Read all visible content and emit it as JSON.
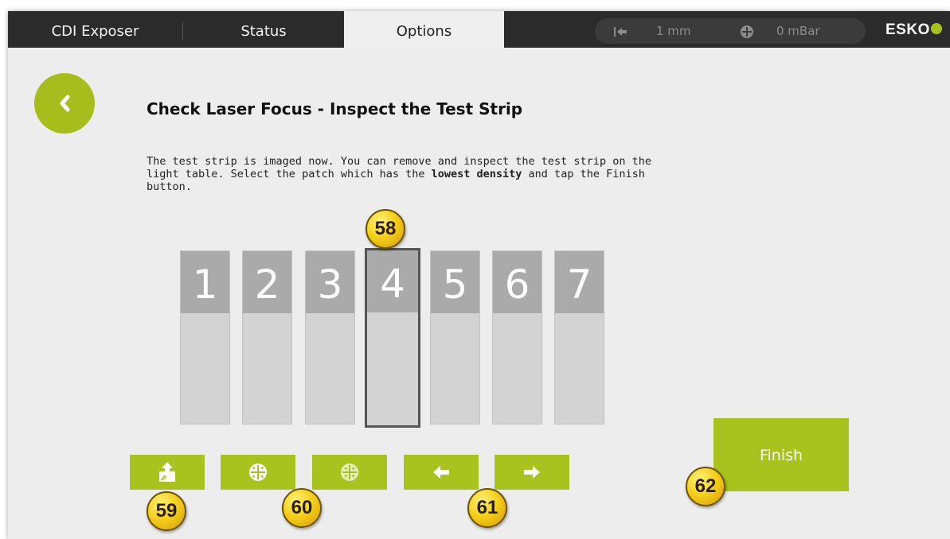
{
  "tabs": [
    {
      "label": "CDI Exposer",
      "active": false
    },
    {
      "label": "Status",
      "active": false
    },
    {
      "label": "Options",
      "active": true
    }
  ],
  "status": {
    "position_value": "1 mm",
    "vacuum_value": "0 mBar"
  },
  "brand": {
    "logo_text": "ESKO"
  },
  "page": {
    "title": "Check Laser Focus - Inspect the Test Strip",
    "desc_part1": "The test strip is imaged now. You can remove and inspect the test strip on the light table. Select the patch which has the ",
    "desc_bold": "lowest density",
    "desc_part2": " and tap the Finish button."
  },
  "patches": [
    {
      "label": "1"
    },
    {
      "label": "2"
    },
    {
      "label": "3"
    },
    {
      "label": "4",
      "selected": true
    },
    {
      "label": "5"
    },
    {
      "label": "6"
    },
    {
      "label": "7"
    }
  ],
  "toolbar": {
    "icons": [
      "eject-icon",
      "vacuum-on-icon",
      "vacuum-off-icon",
      "arrow-left-icon",
      "arrow-right-icon"
    ]
  },
  "finish": {
    "label": "Finish"
  },
  "callouts": [
    "58",
    "59",
    "60",
    "61",
    "62"
  ],
  "colors": {
    "accent": "#a8c21e",
    "topbar": "#2b2b2b",
    "background": "#ededed",
    "patch_head": "#aaaaaa",
    "patch_body": "#d3d3d3"
  }
}
